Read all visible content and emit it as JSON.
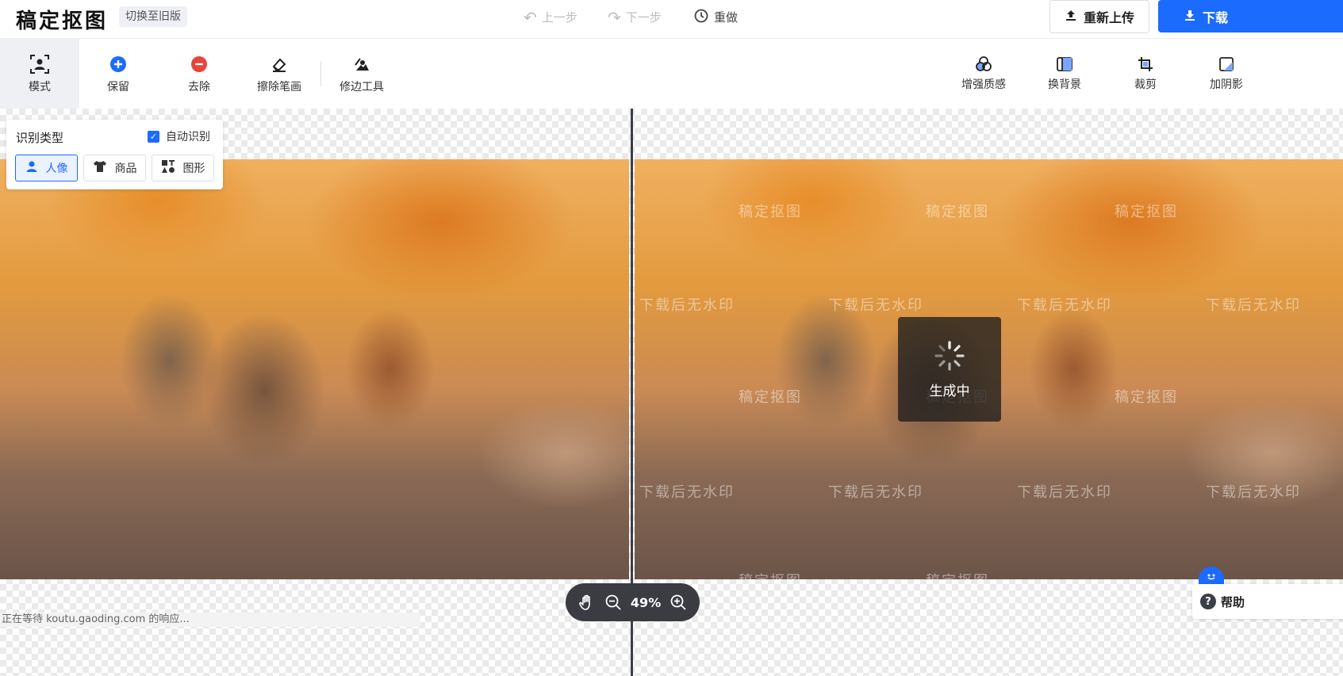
{
  "app": {
    "brand": "稿定抠图",
    "switch_old": "切换至旧版"
  },
  "history": {
    "undo": "上一步",
    "redo_step": "下一步",
    "redo": "重做"
  },
  "actions": {
    "reupload": "重新上传",
    "download": "下载"
  },
  "toolbar": {
    "left_tools": [
      {
        "label": "模式",
        "icon": "portrait-mode-icon",
        "active": true
      },
      {
        "label": "保留",
        "icon": "plus-circle-icon"
      },
      {
        "label": "去除",
        "icon": "minus-circle-icon"
      },
      {
        "label": "擦除笔画",
        "icon": "eraser-icon"
      },
      {
        "label": "修边工具",
        "icon": "edge-tool-icon"
      }
    ],
    "right_tools": [
      {
        "label": "增强质感",
        "icon": "enhance-icon"
      },
      {
        "label": "换背景",
        "icon": "background-icon"
      },
      {
        "label": "裁剪",
        "icon": "crop-icon"
      },
      {
        "label": "加阴影",
        "icon": "shadow-icon"
      }
    ]
  },
  "identify_panel": {
    "title": "识别类型",
    "auto_label": "自动识别",
    "auto_checked": true,
    "categories": [
      {
        "label": "人像",
        "icon": "person-icon",
        "active": true
      },
      {
        "label": "商品",
        "icon": "tshirt-icon"
      },
      {
        "label": "图形",
        "icon": "shapes-icon"
      }
    ]
  },
  "preview": {
    "watermark_brand": "稿定抠图",
    "watermark_note": "下载后无水印",
    "generating": "生成中"
  },
  "zoom": {
    "level": "49%"
  },
  "help": {
    "label": "帮助"
  },
  "status": {
    "text": "正在等待 koutu.gaoding.com 的响应..."
  },
  "colors": {
    "accent": "#1c6bff",
    "remove": "#e8443a"
  }
}
